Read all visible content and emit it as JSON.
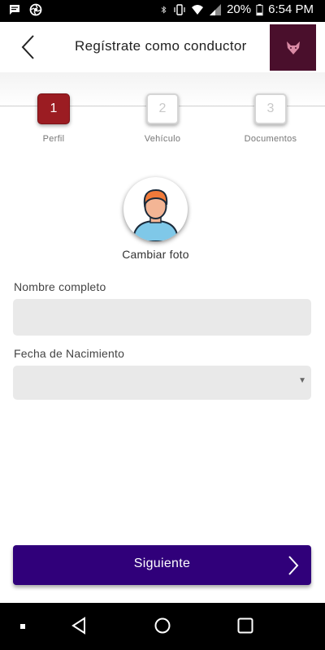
{
  "status_bar": {
    "battery": "20%",
    "time": "6:54 PM"
  },
  "header": {
    "title": "Regístrate como conductor"
  },
  "stepper": {
    "steps": [
      {
        "number": "1",
        "label": "Perfil",
        "active": true
      },
      {
        "number": "2",
        "label": "Vehículo",
        "active": false
      },
      {
        "number": "3",
        "label": "Documentos",
        "active": false
      }
    ]
  },
  "profile": {
    "change_photo": "Cambiar foto"
  },
  "form": {
    "name_label": "Nombre completo",
    "name_value": "",
    "birth_label": "Fecha de Nacimiento",
    "birth_value": ""
  },
  "actions": {
    "next_label": "Siguiente"
  },
  "colors": {
    "primary": "#30007a",
    "step_active": "#9b1c22",
    "logo_bg": "#4a0f2c"
  }
}
